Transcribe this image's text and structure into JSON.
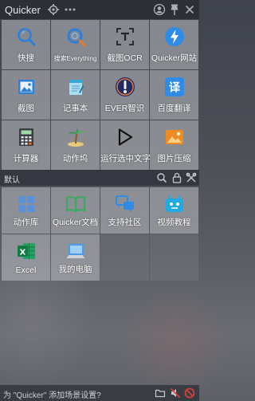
{
  "app": {
    "title": "Quicker"
  },
  "titlebar": {
    "icons": [
      "gear-icon",
      "more-dots-icon",
      "user-icon",
      "pin-icon",
      "close-icon"
    ]
  },
  "main_panel": {
    "items": [
      {
        "label": "快搜",
        "icon": "search-icon"
      },
      {
        "label": "搜索Everything",
        "icon": "everything-search-icon"
      },
      {
        "label": "截图OCR",
        "icon": "ocr-icon"
      },
      {
        "label": "Quicker网站",
        "icon": "lightning-icon"
      },
      {
        "label": "截图",
        "icon": "screenshot-icon"
      },
      {
        "label": "记事本",
        "icon": "notepad-icon"
      },
      {
        "label": "EVER智识",
        "icon": "ever-icon"
      },
      {
        "label": "百度翻译",
        "icon": "translate-icon"
      },
      {
        "label": "计算器",
        "icon": "calculator-icon"
      },
      {
        "label": "动作坞",
        "icon": "palm-tree-icon"
      },
      {
        "label": "运行选中文字",
        "icon": "play-icon"
      },
      {
        "label": "图片压缩",
        "icon": "image-compress-icon"
      }
    ]
  },
  "default_section": {
    "title": "默认",
    "icons": [
      "search-icon",
      "lock-icon",
      "settings-tools-icon"
    ],
    "items": [
      {
        "label": "动作库",
        "icon": "action-library-icon"
      },
      {
        "label": "Quicker文档",
        "icon": "book-icon"
      },
      {
        "label": "支持社区",
        "icon": "chat-bubbles-icon"
      },
      {
        "label": "视频教程",
        "icon": "video-robot-icon"
      },
      {
        "label": "Excel",
        "icon": "excel-icon"
      },
      {
        "label": "我的电脑",
        "icon": "computer-icon"
      }
    ]
  },
  "statusbar": {
    "text": "为 \"Quicker\" 添加场景设置?",
    "icons": [
      "folder-icon",
      "mute-icon",
      "no-entry-icon"
    ]
  },
  "colors": {
    "titlebar_bg": "#2c2f36",
    "cell_bg": "#bdbfc4",
    "accent_blue": "#2d7fd8"
  }
}
